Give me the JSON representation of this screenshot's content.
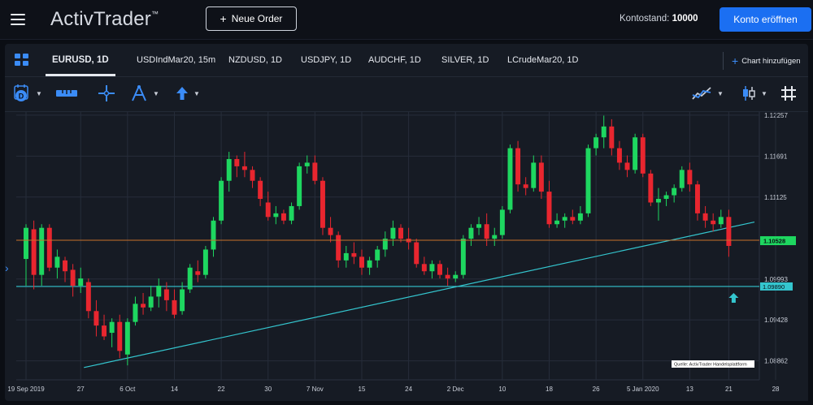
{
  "header": {
    "logo": "ActivTrader",
    "logo_tm": "™",
    "new_order_label": "Neue Order",
    "balance_label": "Kontostand:",
    "balance_value": "10000",
    "open_account_label": "Konto eröffnen"
  },
  "tabs": [
    {
      "label": "EURUSD, 1D",
      "active": true
    },
    {
      "label": "USDIndMar20, 15m"
    },
    {
      "label": "NZDUSD, 1D"
    },
    {
      "label": "USDJPY, 1D"
    },
    {
      "label": "AUDCHF, 1D"
    },
    {
      "label": "SILVER, 1D"
    },
    {
      "label": "LCrudeMar20, 1D"
    }
  ],
  "add_chart_label": "Chart hinzufügen",
  "colors": {
    "up": "#1ed760",
    "down": "#e8262f",
    "accent": "#3b8cf7",
    "orange_line": "#c8702a",
    "cyan_line": "#34c6cf"
  },
  "chart_data": {
    "type": "candlestick",
    "symbol": "EURUSD",
    "interval": "1D",
    "y_ticks": [
      "1.12257",
      "1.11691",
      "1.11125",
      "1.09993",
      "1.09428",
      "1.08862"
    ],
    "x_ticks": [
      "19 Sep 2019",
      "27",
      "6 Oct",
      "14",
      "22",
      "30",
      "7 Nov",
      "15",
      "24",
      "2 Dec",
      "10",
      "18",
      "26",
      "5 Jan 2020",
      "13",
      "21",
      "28"
    ],
    "ylim": [
      1.086,
      1.123
    ],
    "price_line": {
      "value": 1.10528,
      "label": "1.10528"
    },
    "horizontal_line": {
      "value": 1.0989,
      "label": "1.09890"
    },
    "trendline": {
      "from": [
        "29 Sep 2019",
        1.0877
      ],
      "to": [
        "25 Jan 2020",
        1.1078
      ]
    },
    "source_note": "Quelle: ActivTrader Handelsplattform",
    "candles": [
      {
        "o": 1.1027,
        "h": 1.1075,
        "l": 1.099,
        "c": 1.107
      },
      {
        "o": 1.1068,
        "h": 1.108,
        "l": 1.0985,
        "c": 1.1005
      },
      {
        "o": 1.1005,
        "h": 1.1075,
        "l": 1.099,
        "c": 1.107
      },
      {
        "o": 1.107,
        "h": 1.1075,
        "l": 1.101,
        "c": 1.1015
      },
      {
        "o": 1.1015,
        "h": 1.104,
        "l": 1.1,
        "c": 1.103
      },
      {
        "o": 1.1025,
        "h": 1.103,
        "l": 1.0995,
        "c": 1.101
      },
      {
        "o": 1.1012,
        "h": 1.102,
        "l": 1.0975,
        "c": 1.099
      },
      {
        "o": 1.099,
        "h": 1.1015,
        "l": 1.098,
        "c": 1.1
      },
      {
        "o": 1.0995,
        "h": 1.1,
        "l": 1.0945,
        "c": 1.0955
      },
      {
        "o": 1.0955,
        "h": 1.097,
        "l": 1.092,
        "c": 1.0935
      },
      {
        "o": 1.0935,
        "h": 1.095,
        "l": 1.0915,
        "c": 1.092
      },
      {
        "o": 1.0925,
        "h": 1.0945,
        "l": 1.0905,
        "c": 1.094
      },
      {
        "o": 1.094,
        "h": 1.095,
        "l": 1.089,
        "c": 1.09
      },
      {
        "o": 1.0895,
        "h": 1.0945,
        "l": 1.088,
        "c": 1.094
      },
      {
        "o": 1.094,
        "h": 1.0975,
        "l": 1.0935,
        "c": 1.0965
      },
      {
        "o": 1.0965,
        "h": 1.098,
        "l": 1.095,
        "c": 1.096
      },
      {
        "o": 1.096,
        "h": 1.099,
        "l": 1.0955,
        "c": 1.0975
      },
      {
        "o": 1.0975,
        "h": 1.1,
        "l": 1.096,
        "c": 1.099
      },
      {
        "o": 1.0985,
        "h": 1.0995,
        "l": 1.0955,
        "c": 1.097
      },
      {
        "o": 1.097,
        "h": 1.0985,
        "l": 1.0945,
        "c": 1.095
      },
      {
        "o": 1.0955,
        "h": 1.0995,
        "l": 1.095,
        "c": 1.0985
      },
      {
        "o": 1.0985,
        "h": 1.102,
        "l": 1.098,
        "c": 1.1015
      },
      {
        "o": 1.101,
        "h": 1.1025,
        "l": 1.0995,
        "c": 1.1005
      },
      {
        "o": 1.1005,
        "h": 1.1045,
        "l": 1.1,
        "c": 1.104
      },
      {
        "o": 1.104,
        "h": 1.1085,
        "l": 1.103,
        "c": 1.108
      },
      {
        "o": 1.108,
        "h": 1.114,
        "l": 1.1075,
        "c": 1.1135
      },
      {
        "o": 1.1135,
        "h": 1.1175,
        "l": 1.112,
        "c": 1.1165
      },
      {
        "o": 1.1165,
        "h": 1.117,
        "l": 1.114,
        "c": 1.1155
      },
      {
        "o": 1.1155,
        "h": 1.1175,
        "l": 1.114,
        "c": 1.115
      },
      {
        "o": 1.115,
        "h": 1.1155,
        "l": 1.1125,
        "c": 1.1135
      },
      {
        "o": 1.1135,
        "h": 1.114,
        "l": 1.11,
        "c": 1.111
      },
      {
        "o": 1.1105,
        "h": 1.112,
        "l": 1.108,
        "c": 1.1085
      },
      {
        "o": 1.1085,
        "h": 1.11,
        "l": 1.1075,
        "c": 1.109
      },
      {
        "o": 1.109,
        "h": 1.1095,
        "l": 1.1075,
        "c": 1.108
      },
      {
        "o": 1.108,
        "h": 1.1105,
        "l": 1.1075,
        "c": 1.11
      },
      {
        "o": 1.11,
        "h": 1.116,
        "l": 1.1095,
        "c": 1.1155
      },
      {
        "o": 1.1155,
        "h": 1.117,
        "l": 1.1145,
        "c": 1.116
      },
      {
        "o": 1.116,
        "h": 1.117,
        "l": 1.113,
        "c": 1.1135
      },
      {
        "o": 1.1135,
        "h": 1.114,
        "l": 1.106,
        "c": 1.107
      },
      {
        "o": 1.107,
        "h": 1.1085,
        "l": 1.105,
        "c": 1.106
      },
      {
        "o": 1.106,
        "h": 1.1065,
        "l": 1.1015,
        "c": 1.1025
      },
      {
        "o": 1.1025,
        "h": 1.1045,
        "l": 1.1015,
        "c": 1.1035
      },
      {
        "o": 1.1035,
        "h": 1.105,
        "l": 1.102,
        "c": 1.103
      },
      {
        "o": 1.103,
        "h": 1.104,
        "l": 1.1005,
        "c": 1.1015
      },
      {
        "o": 1.1015,
        "h": 1.103,
        "l": 1.1005,
        "c": 1.1025
      },
      {
        "o": 1.1025,
        "h": 1.1045,
        "l": 1.1015,
        "c": 1.104
      },
      {
        "o": 1.104,
        "h": 1.1065,
        "l": 1.103,
        "c": 1.1055
      },
      {
        "o": 1.1055,
        "h": 1.108,
        "l": 1.1045,
        "c": 1.107
      },
      {
        "o": 1.107,
        "h": 1.1075,
        "l": 1.105,
        "c": 1.1055
      },
      {
        "o": 1.1055,
        "h": 1.107,
        "l": 1.104,
        "c": 1.105
      },
      {
        "o": 1.105,
        "h": 1.1055,
        "l": 1.1015,
        "c": 1.102
      },
      {
        "o": 1.102,
        "h": 1.103,
        "l": 1.1005,
        "c": 1.101
      },
      {
        "o": 1.101,
        "h": 1.1025,
        "l": 1.1,
        "c": 1.102
      },
      {
        "o": 1.102,
        "h": 1.1025,
        "l": 1.1,
        "c": 1.1005
      },
      {
        "o": 1.1005,
        "h": 1.1015,
        "l": 1.099,
        "c": 1.1
      },
      {
        "o": 1.1,
        "h": 1.101,
        "l": 1.0995,
        "c": 1.1005
      },
      {
        "o": 1.1005,
        "h": 1.106,
        "l": 1.1,
        "c": 1.1055
      },
      {
        "o": 1.1055,
        "h": 1.1075,
        "l": 1.1045,
        "c": 1.107
      },
      {
        "o": 1.107,
        "h": 1.1085,
        "l": 1.106,
        "c": 1.1075
      },
      {
        "o": 1.1075,
        "h": 1.109,
        "l": 1.1045,
        "c": 1.1055
      },
      {
        "o": 1.1055,
        "h": 1.107,
        "l": 1.1045,
        "c": 1.106
      },
      {
        "o": 1.106,
        "h": 1.11,
        "l": 1.1055,
        "c": 1.1095
      },
      {
        "o": 1.1095,
        "h": 1.1185,
        "l": 1.109,
        "c": 1.118
      },
      {
        "o": 1.118,
        "h": 1.119,
        "l": 1.112,
        "c": 1.113
      },
      {
        "o": 1.113,
        "h": 1.114,
        "l": 1.1115,
        "c": 1.1125
      },
      {
        "o": 1.1125,
        "h": 1.117,
        "l": 1.112,
        "c": 1.116
      },
      {
        "o": 1.116,
        "h": 1.117,
        "l": 1.111,
        "c": 1.112
      },
      {
        "o": 1.112,
        "h": 1.1135,
        "l": 1.107,
        "c": 1.1075
      },
      {
        "o": 1.1075,
        "h": 1.109,
        "l": 1.107,
        "c": 1.108
      },
      {
        "o": 1.108,
        "h": 1.109,
        "l": 1.107,
        "c": 1.1085
      },
      {
        "o": 1.1085,
        "h": 1.1095,
        "l": 1.1075,
        "c": 1.108
      },
      {
        "o": 1.108,
        "h": 1.11,
        "l": 1.1075,
        "c": 1.109
      },
      {
        "o": 1.109,
        "h": 1.1185,
        "l": 1.1085,
        "c": 1.118
      },
      {
        "o": 1.118,
        "h": 1.12,
        "l": 1.117,
        "c": 1.1195
      },
      {
        "o": 1.1195,
        "h": 1.1225,
        "l": 1.118,
        "c": 1.121
      },
      {
        "o": 1.121,
        "h": 1.122,
        "l": 1.117,
        "c": 1.118
      },
      {
        "o": 1.118,
        "h": 1.119,
        "l": 1.115,
        "c": 1.116
      },
      {
        "o": 1.116,
        "h": 1.117,
        "l": 1.114,
        "c": 1.115
      },
      {
        "o": 1.115,
        "h": 1.12,
        "l": 1.1145,
        "c": 1.1195
      },
      {
        "o": 1.1195,
        "h": 1.12,
        "l": 1.114,
        "c": 1.1145
      },
      {
        "o": 1.1145,
        "h": 1.115,
        "l": 1.11,
        "c": 1.1105
      },
      {
        "o": 1.1105,
        "h": 1.1125,
        "l": 1.108,
        "c": 1.111
      },
      {
        "o": 1.111,
        "h": 1.112,
        "l": 1.11,
        "c": 1.1115
      },
      {
        "o": 1.1115,
        "h": 1.113,
        "l": 1.1105,
        "c": 1.1125
      },
      {
        "o": 1.1125,
        "h": 1.1155,
        "l": 1.112,
        "c": 1.115
      },
      {
        "o": 1.115,
        "h": 1.116,
        "l": 1.112,
        "c": 1.113
      },
      {
        "o": 1.113,
        "h": 1.1135,
        "l": 1.108,
        "c": 1.109
      },
      {
        "o": 1.109,
        "h": 1.11,
        "l": 1.107,
        "c": 1.108
      },
      {
        "o": 1.108,
        "h": 1.109,
        "l": 1.1065,
        "c": 1.1075
      },
      {
        "o": 1.1075,
        "h": 1.1095,
        "l": 1.107,
        "c": 1.1085
      },
      {
        "o": 1.1085,
        "h": 1.1095,
        "l": 1.103,
        "c": 1.1045
      }
    ]
  }
}
